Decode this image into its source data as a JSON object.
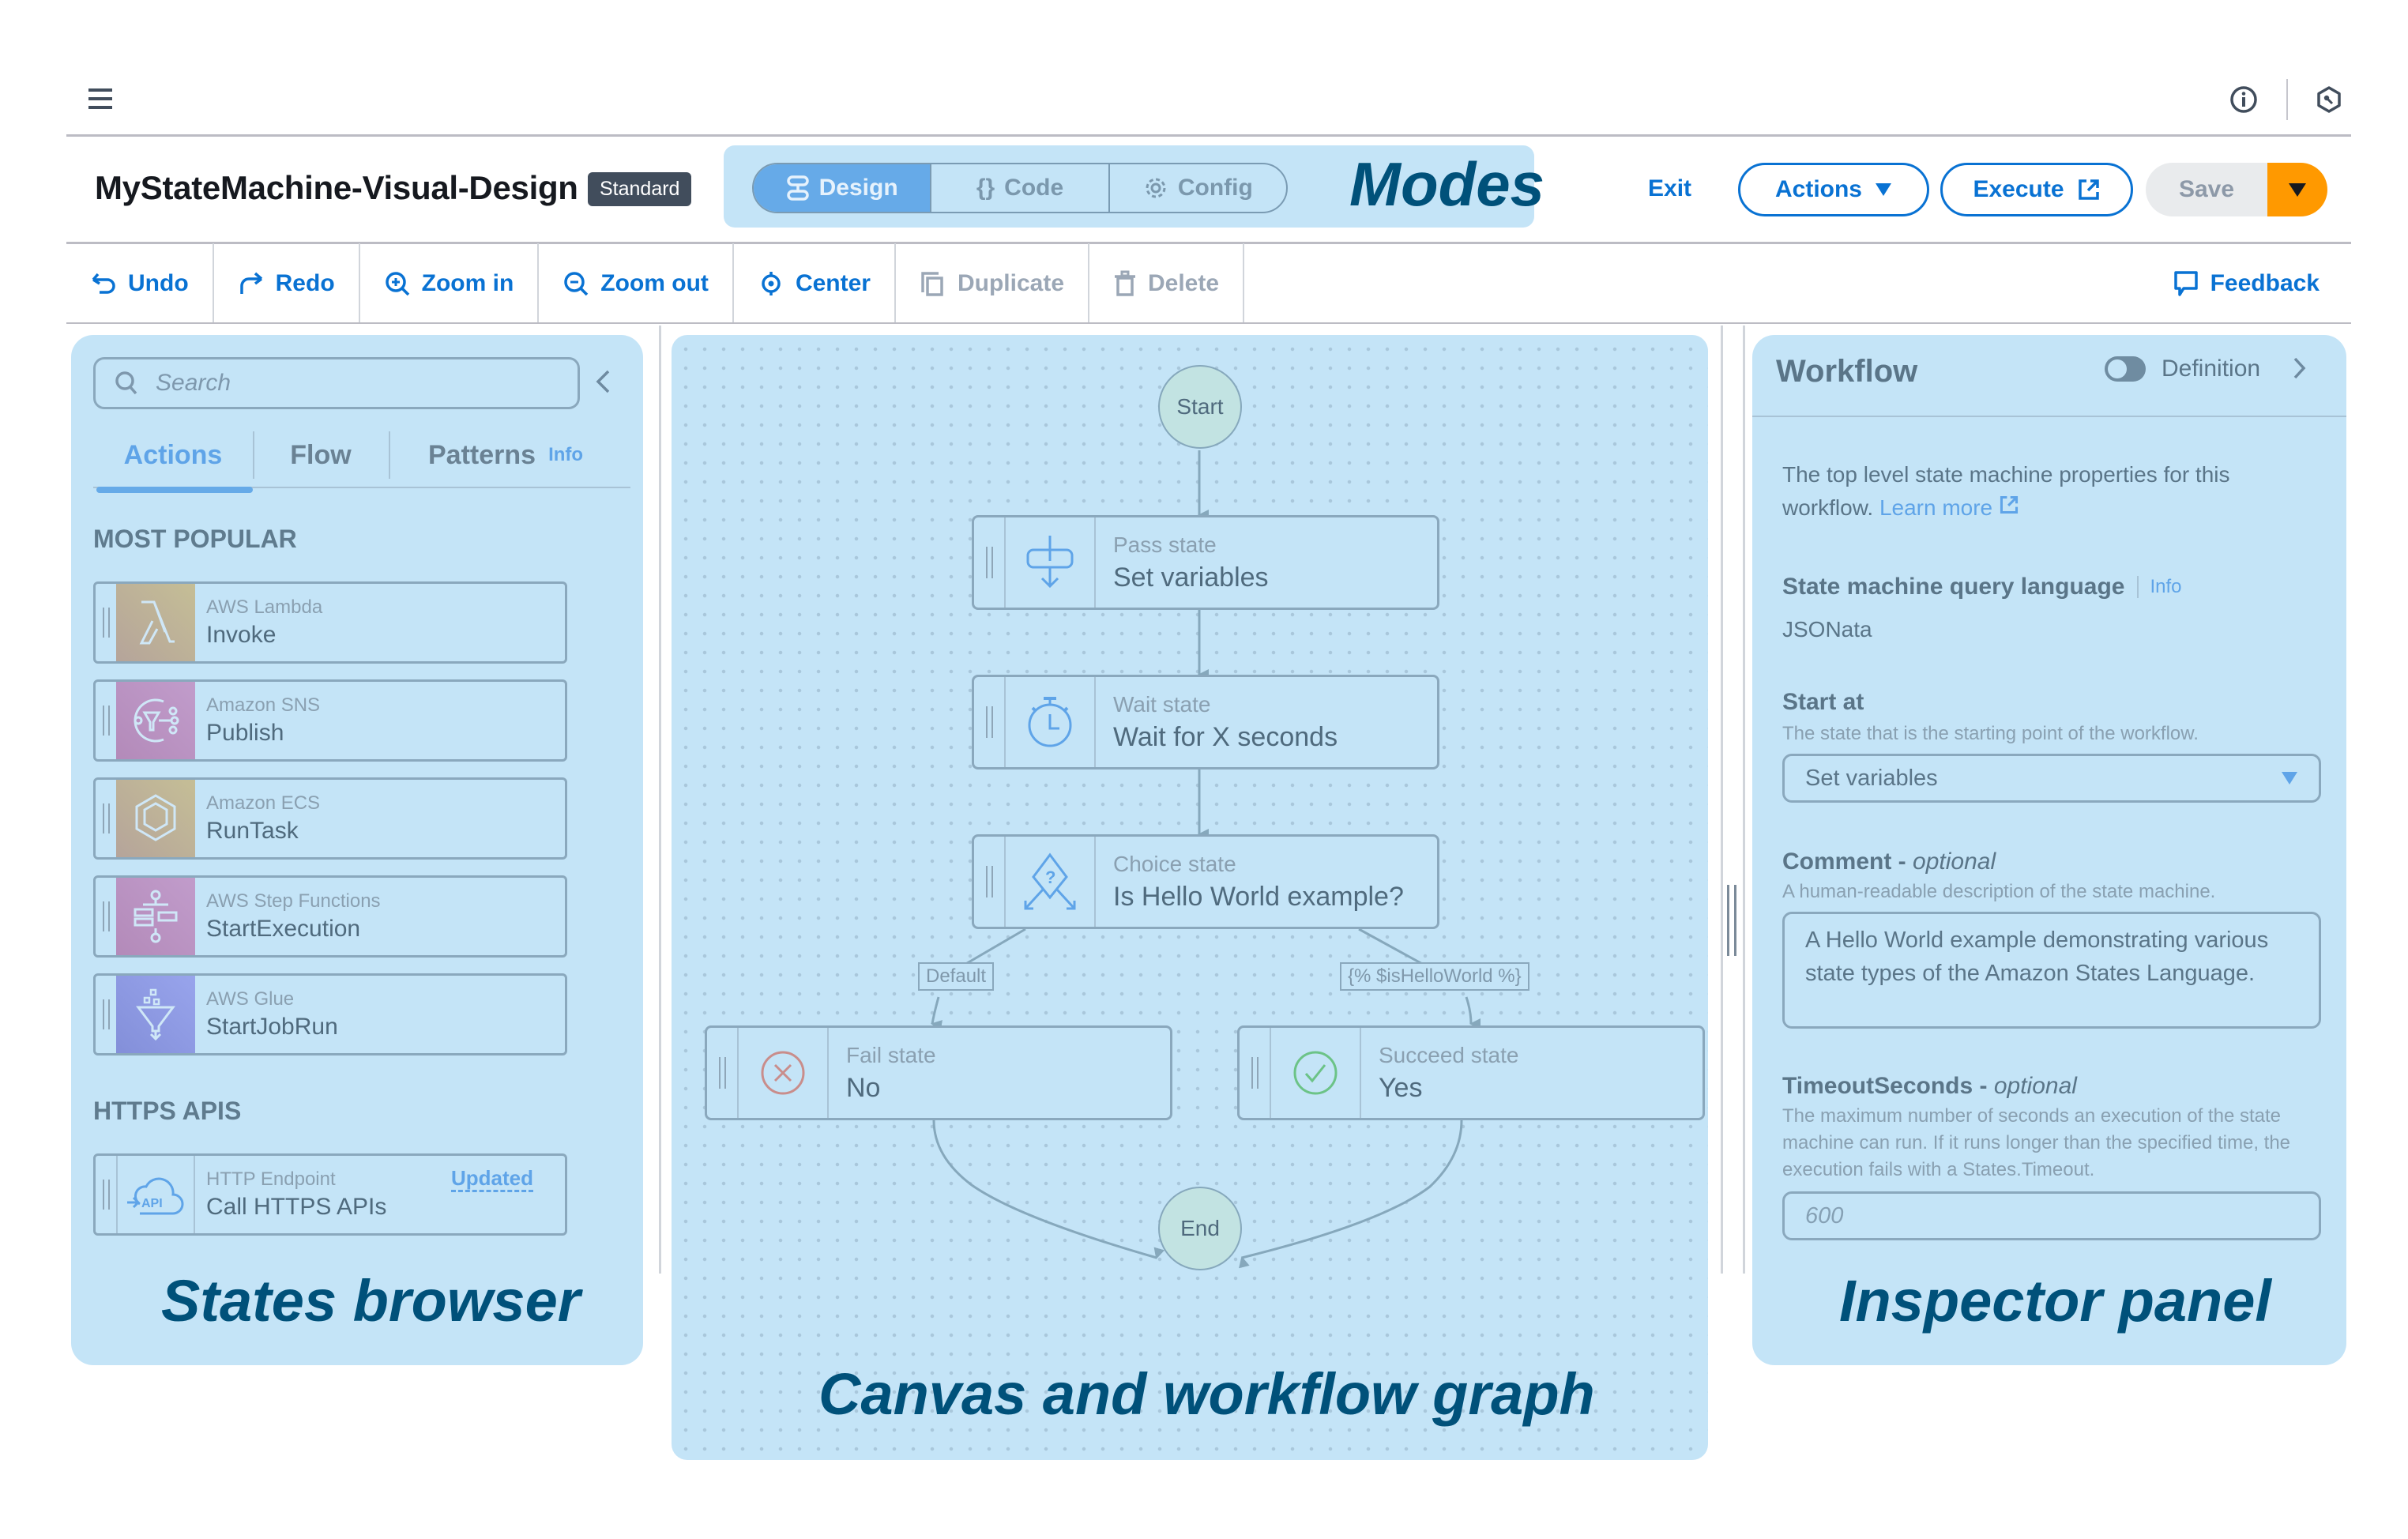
{
  "app": {
    "title": "MyStateMachine-Visual-Design",
    "type_badge": "Standard"
  },
  "top_icons": [
    "info-icon",
    "settings-hexagon-icon"
  ],
  "modes": {
    "label": "Modes",
    "options": [
      {
        "label": "Design",
        "icon": "design-icon",
        "active": true
      },
      {
        "label": "Code",
        "icon": "code-braces-icon",
        "active": false
      },
      {
        "label": "Config",
        "icon": "gear-icon",
        "active": false
      }
    ]
  },
  "header_actions": {
    "exit": "Exit",
    "actions": "Actions",
    "execute": "Execute",
    "save": "Save"
  },
  "toolbar": {
    "undo": "Undo",
    "redo": "Redo",
    "zoom_in": "Zoom in",
    "zoom_out": "Zoom out",
    "center": "Center",
    "duplicate": "Duplicate",
    "delete": "Delete",
    "feedback": "Feedback"
  },
  "states_browser": {
    "search_placeholder": "Search",
    "tabs": [
      {
        "label": "Actions",
        "active": true
      },
      {
        "label": "Flow",
        "active": false
      },
      {
        "label": "Patterns",
        "active": false,
        "info": "Info"
      }
    ],
    "most_popular_heading": "MOST POPULAR",
    "most_popular": [
      {
        "service": "AWS Lambda",
        "action": "Invoke",
        "icon": "lambda-icon",
        "color": "#c5b896"
      },
      {
        "service": "Amazon SNS",
        "action": "Publish",
        "icon": "sns-icon",
        "color": "#bc93c5"
      },
      {
        "service": "Amazon ECS",
        "action": "RunTask",
        "icon": "ecs-icon",
        "color": "#c5b896"
      },
      {
        "service": "AWS Step Functions",
        "action": "StartExecution",
        "icon": "step-functions-icon",
        "color": "#bc93c5"
      },
      {
        "service": "AWS Glue",
        "action": "StartJobRun",
        "icon": "glue-icon",
        "color": "#8e9ce8"
      }
    ],
    "https_heading": "HTTPS APIS",
    "https_items": [
      {
        "service": "HTTP Endpoint",
        "action": "Call HTTPS APIs",
        "badge": "Updated",
        "icon": "api-cloud-icon"
      }
    ],
    "annotation": "States browser"
  },
  "canvas": {
    "annotation": "Canvas and workflow graph",
    "start_label": "Start",
    "end_label": "End",
    "states": [
      {
        "type": "Pass state",
        "name": "Set variables",
        "icon": "pass-icon"
      },
      {
        "type": "Wait state",
        "name": "Wait for X seconds",
        "icon": "timer-icon"
      },
      {
        "type": "Choice state",
        "name": "Is Hello World example?",
        "icon": "choice-icon"
      },
      {
        "type": "Fail state",
        "name": "No",
        "icon": "fail-x-icon"
      },
      {
        "type": "Succeed state",
        "name": "Yes",
        "icon": "succeed-check-icon"
      }
    ],
    "edge_labels": {
      "default": "Default",
      "condition": "{% $isHelloWorld %}"
    }
  },
  "inspector": {
    "title": "Workflow",
    "toggle_label": "Definition",
    "toggle_on": false,
    "description": "The top level state machine properties for this workflow.",
    "learn_more": "Learn more",
    "query_language": {
      "label": "State machine query language",
      "info": "Info",
      "value": "JSONata"
    },
    "start_at": {
      "label": "Start at",
      "description": "The state that is the starting point of the workflow.",
      "value": "Set variables"
    },
    "comment": {
      "label": "Comment",
      "optional": "optional",
      "description": "A human-readable description of the state machine.",
      "value": "A Hello World example demonstrating various state types of the Amazon States Language."
    },
    "timeout": {
      "label": "TimeoutSeconds",
      "optional": "optional",
      "description": "The maximum number of seconds an execution of the state machine can run. If it runs longer than the specified time, the execution fails with a States.Timeout.",
      "placeholder": "600"
    },
    "annotation": "Inspector panel"
  },
  "colors": {
    "accent": "#0972d3",
    "save_dropdown": "#ff9900",
    "highlight_overlay": "#c4e4f7",
    "annotation_text": "#00517a"
  }
}
